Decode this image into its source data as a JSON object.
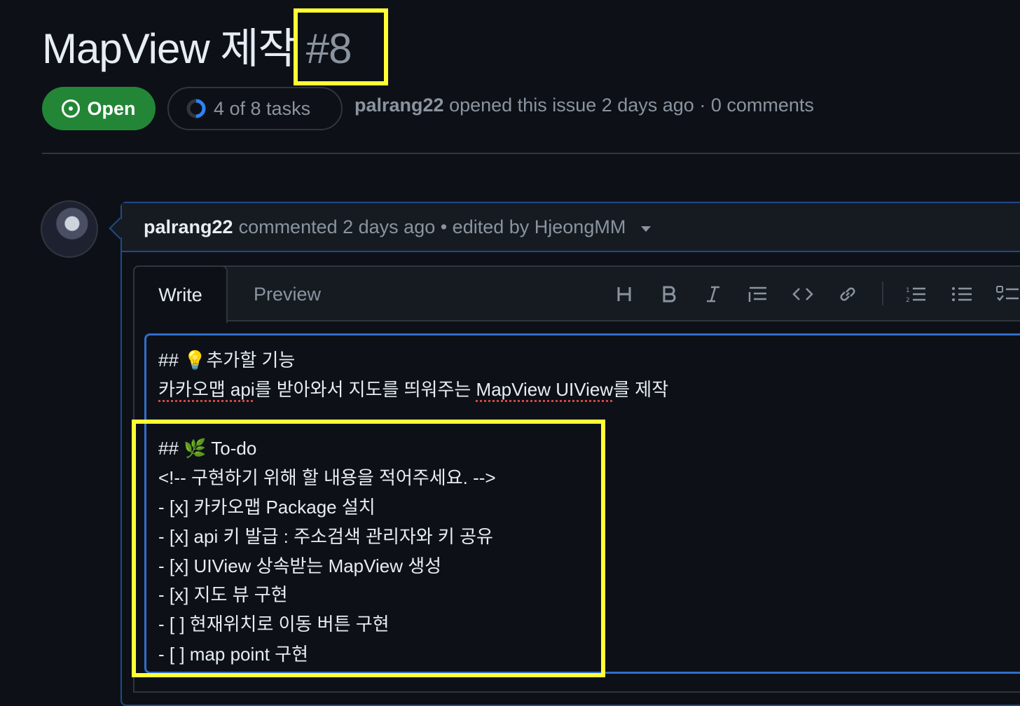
{
  "issue": {
    "title": "MapView 제작",
    "number": "#8",
    "status_label": "Open",
    "tasks_label": "4 of 8 tasks",
    "tasks_progress": 0.5,
    "author": "palrang22",
    "meta_text": "opened this issue 2 days ago · 0 comments"
  },
  "comment": {
    "author": "palrang22",
    "meta_text": "commented 2 days ago • edited by HjeongMM"
  },
  "editor": {
    "tabs": {
      "write": "Write",
      "preview": "Preview"
    },
    "toolbar": [
      "heading-icon",
      "bold-icon",
      "italic-icon",
      "quote-icon",
      "code-icon",
      "link-icon",
      "ordered-list-icon",
      "unordered-list-icon",
      "task-list-icon"
    ],
    "lines": {
      "l1": "## 💡추가할 기능",
      "l2_a": "카카오맵 api",
      "l2_b": "를 받아와서 지도를 띄워주는 ",
      "l2_c": "MapView UIView",
      "l2_d": "를 제작",
      "l3": "## 🌿  To-do",
      "l4": "<!-- 구현하기 위해 할 내용을 적어주세요. -->",
      "l5": "- [x] 카카오맵 Package 설치",
      "l6": "- [x] api 키 발급 : 주소검색 관리자와 키 공유",
      "l7": "- [x] UIView 상속받는 MapView 생성",
      "l8": "- [x] 지도 뷰 구현",
      "l9": "- [ ] 현재위치로 이동 버튼 구현",
      "l10": "- [ ] map point 구현"
    }
  },
  "colors": {
    "background": "#0d1117",
    "open_green": "#238636",
    "highlight": "#ffff33",
    "focus_blue": "#316dca"
  }
}
